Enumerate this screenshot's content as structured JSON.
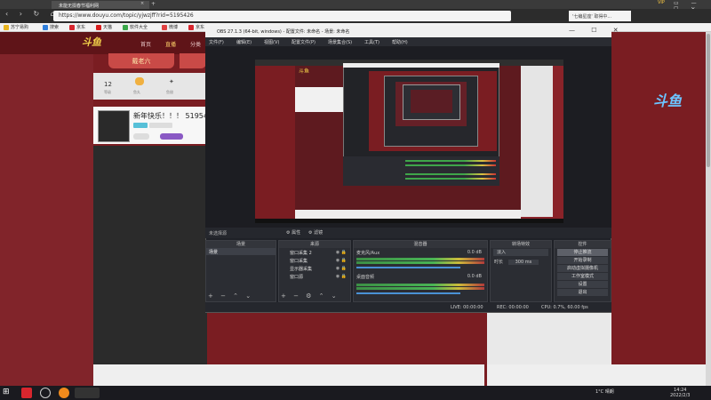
{
  "browser": {
    "tab_title": "未能无损春节福利网",
    "tab_close": "×",
    "tab_add": "+",
    "vip": "VIP",
    "window_controls": "▭ — ☐ ✕",
    "url": "https://www.douyu.com/topic/yjwzjff?rid=5195426",
    "search_placeholder": "'七编星座' 取得中...",
    "nav_glyphs": "‹ › ↻ ⌂"
  },
  "bookmarks": [
    {
      "label": "苏宁易购",
      "icon": "suning-icon",
      "color": "#e8b420"
    },
    {
      "label": "搜索",
      "icon": "search-icon",
      "color": "#2f7fdc"
    },
    {
      "label": "京东",
      "icon": "jd-icon",
      "color": "#d8262e"
    },
    {
      "label": "天猫",
      "icon": "tmall-icon",
      "color": "#d81e1e"
    },
    {
      "label": "软件大全",
      "icon": "software-icon",
      "color": "#3aa84a"
    },
    {
      "label": "微博",
      "icon": "weibo-icon",
      "color": "#e04040"
    },
    {
      "label": "京东",
      "icon": "jd-icon",
      "color": "#d8262e"
    }
  ],
  "page": {
    "nav": [
      "首页",
      "直播",
      "分类"
    ],
    "room_tab": "戴老六",
    "stat_num": "12",
    "stat_labels": [
      "等级",
      "鱼丸",
      "鱼翅"
    ],
    "room_title": "新年快乐！！！ 519542",
    "banner": "斗鱼"
  },
  "obs": {
    "title": "OBS 27.1.3 (64-bit, windows) - 配置文件: 未命名 - 场景: 未命名",
    "window_controls": "—  ☐  ✕",
    "menu": [
      "文件(F)",
      "编辑(E)",
      "视图(V)",
      "配置文件(P)",
      "场景集合(S)",
      "工具(T)",
      "帮助(H)"
    ],
    "no_source": "未选择源",
    "props": "⚙ 属性",
    "filters": "⚙ 滤镜",
    "docks": {
      "scenes": {
        "title": "场景",
        "items": [
          "场景"
        ]
      },
      "sources": {
        "title": "来源",
        "items": [
          "窗口采集 2",
          "窗口采集",
          "显示器采集",
          "窗口源"
        ]
      },
      "mixer": {
        "title": "混音器",
        "channels": [
          {
            "name": "麦克风/Aux",
            "db": "0.0 dB"
          },
          {
            "name": "桌面音频",
            "db": "0.0 dB"
          }
        ]
      },
      "transitions": {
        "title": "转场特效",
        "type": "淡入",
        "duration_label": "时长",
        "duration": "300 ms"
      },
      "controls": {
        "title": "控件",
        "buttons": [
          "停止推流",
          "开始录制",
          "启动虚拟摄像机",
          "工作室模式",
          "设置",
          "退出"
        ]
      }
    },
    "status": {
      "live": "LIVE: 00:00:00",
      "rec": "REC: 00:00:00",
      "cpu": "CPU: 0.7%, 60.00 fps"
    }
  },
  "taskbar": {
    "temp": "1°C  晴朗",
    "time": "14:24",
    "date": "2022/2/3"
  }
}
